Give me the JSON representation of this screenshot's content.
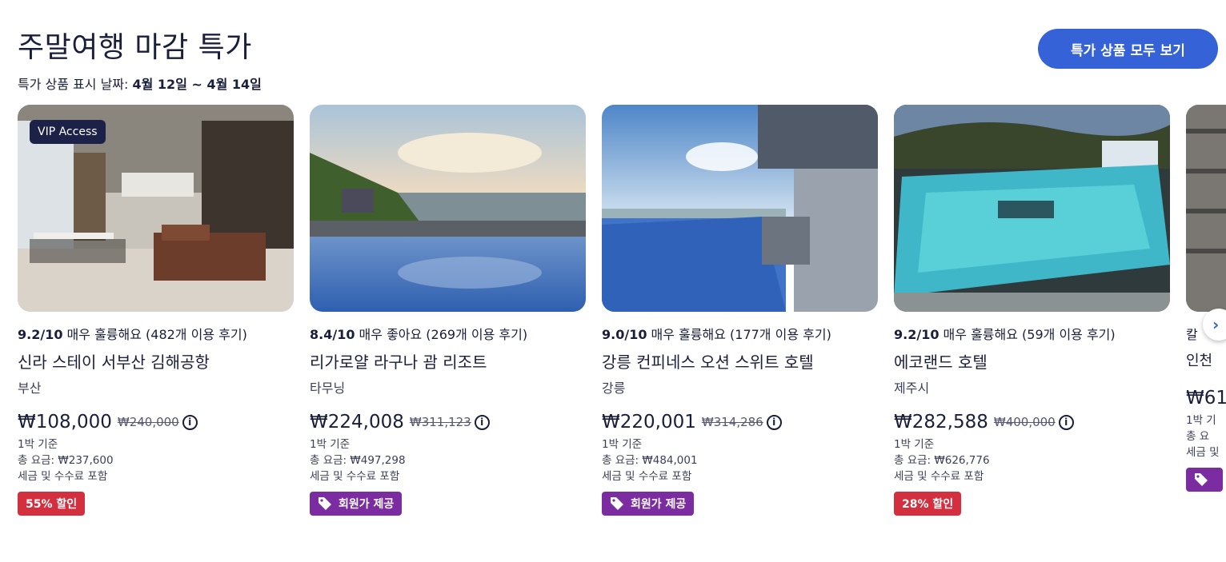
{
  "header": {
    "title": "주말여행 마감 특가",
    "date_prefix": "특가 상품 표시 날짜: ",
    "date_range": "4월 12일 ~ 4월 14일",
    "see_all_label": "특가 상품 모두 보기"
  },
  "cards": [
    {
      "badge_top": "VIP Access",
      "score": "9.2/10",
      "rating_text": " 매우 훌륭해요 (482개 이용 후기)",
      "name": "신라 스테이 서부산 김해공항",
      "location": "부산",
      "price": "₩108,000",
      "old_price": "₩240,000",
      "per_night": "1박 기준",
      "total": " 총 요금: ₩237,600",
      "tax": "세금 및 수수료 포함",
      "deal": "55% 할인",
      "deal_color": "#d32f3f"
    },
    {
      "score": "8.4/10",
      "rating_text": " 매우 좋아요 (269개 이용 후기)",
      "name": "리가로얄 라구나 괌 리조트",
      "location": "타무닝",
      "price": "₩224,008",
      "old_price": "₩311,123",
      "per_night": "1박 기준",
      "total": " 총 요금: ₩497,298",
      "tax": "세금 및 수수료 포함",
      "deal": "회원가 제공",
      "deal_color": "#7b2ca0"
    },
    {
      "score": "9.0/10",
      "rating_text": " 매우 훌륭해요 (177개 이용 후기)",
      "name": "강릉 컨피네스 오션 스위트 호텔",
      "location": "강릉",
      "price": "₩220,001",
      "old_price": "₩314,286",
      "per_night": "1박 기준",
      "total": " 총 요금: ₩484,001",
      "tax": "세금 및 수수료 포함",
      "deal": "회원가 제공",
      "deal_color": "#7b2ca0"
    },
    {
      "score": "9.2/10",
      "rating_text": " 매우 훌륭해요 (59개 이용 후기)",
      "name": "에코랜드 호텔",
      "location": "제주시",
      "price": "₩282,588",
      "old_price": "₩400,000",
      "per_night": "1박 기준",
      "total": " 총 요금: ₩626,776",
      "tax": "세금 및 수수료 포함",
      "deal": "28% 할인",
      "deal_color": "#d32f3f"
    },
    {
      "score": "",
      "rating_text": "칼",
      "name": "인천",
      "location": "",
      "price": "₩61",
      "old_price": "",
      "per_night": "1박 기",
      "total": " 총 요",
      "tax": "세금 및",
      "deal": "",
      "deal_color": "#7b2ca0"
    }
  ],
  "icons": {
    "info": "info-icon",
    "tag": "tag-icon",
    "next": "chevron-right-icon"
  },
  "info_glyph": "i",
  "next_glyph": "›"
}
